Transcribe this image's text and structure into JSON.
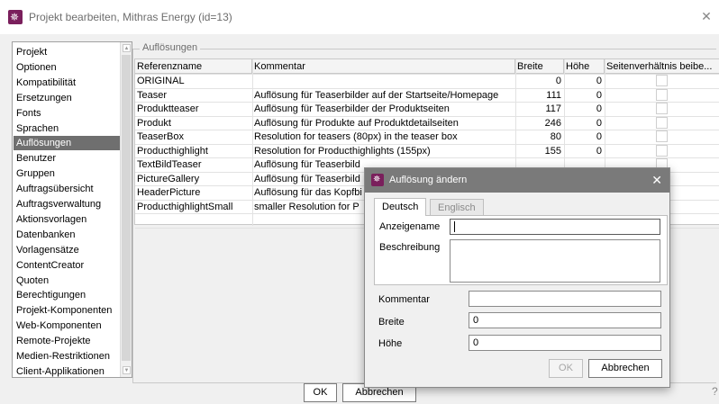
{
  "window": {
    "title": "Projekt bearbeiten, Mithras Energy (id=13)",
    "close_symbol": "✕"
  },
  "sidebar": {
    "items": [
      {
        "label": "Projekt",
        "selected": false
      },
      {
        "label": "Optionen",
        "selected": false
      },
      {
        "label": "Kompatibilität",
        "selected": false
      },
      {
        "label": "Ersetzungen",
        "selected": false
      },
      {
        "label": "Fonts",
        "selected": false
      },
      {
        "label": "Sprachen",
        "selected": false
      },
      {
        "label": "Auflösungen",
        "selected": true
      },
      {
        "label": "Benutzer",
        "selected": false
      },
      {
        "label": "Gruppen",
        "selected": false
      },
      {
        "label": "Auftragsübersicht",
        "selected": false
      },
      {
        "label": "Auftragsverwaltung",
        "selected": false
      },
      {
        "label": "Aktionsvorlagen",
        "selected": false
      },
      {
        "label": "Datenbanken",
        "selected": false
      },
      {
        "label": "Vorlagensätze",
        "selected": false
      },
      {
        "label": "ContentCreator",
        "selected": false
      },
      {
        "label": "Quoten",
        "selected": false
      },
      {
        "label": "Berechtigungen",
        "selected": false
      },
      {
        "label": "Projekt-Komponenten",
        "selected": false
      },
      {
        "label": "Web-Komponenten",
        "selected": false
      },
      {
        "label": "Remote-Projekte",
        "selected": false
      },
      {
        "label": "Medien-Restriktionen",
        "selected": false
      },
      {
        "label": "Client-Applikationen",
        "selected": false
      }
    ]
  },
  "resolutions": {
    "group_label": "Auflösungen",
    "columns": [
      "Referenzname",
      "Kommentar",
      "Breite",
      "Höhe",
      "Seitenverhältnis beibe..."
    ],
    "rows": [
      {
        "name": "ORIGINAL",
        "comment": "",
        "width": "0",
        "height": "0"
      },
      {
        "name": "Teaser",
        "comment": "Auflösung für Teaserbilder auf der Startseite/Homepage",
        "width": "111",
        "height": "0"
      },
      {
        "name": "Produktteaser",
        "comment": "Auflösung für Teaserbilder der Produktseiten",
        "width": "117",
        "height": "0"
      },
      {
        "name": "Produkt",
        "comment": "Auflösung für Produkte auf Produktdetailseiten",
        "width": "246",
        "height": "0"
      },
      {
        "name": "TeaserBox",
        "comment": "Resolution for teasers (80px) in the teaser box",
        "width": "80",
        "height": "0"
      },
      {
        "name": "Producthighlight",
        "comment": "Resolution for Producthighlights (155px)",
        "width": "155",
        "height": "0"
      },
      {
        "name": "TextBildTeaser",
        "comment": "Auflösung für Teaserbild",
        "width": "",
        "height": ""
      },
      {
        "name": "PictureGallery",
        "comment": "Auflösung für Teaserbild",
        "width": "",
        "height": ""
      },
      {
        "name": "HeaderPicture",
        "comment": "Auflösung für das Kopfbi",
        "width": "",
        "height": ""
      },
      {
        "name": "ProducthighlightSmall",
        "comment": "smaller Resolution for P",
        "width": "",
        "height": ""
      }
    ]
  },
  "footer": {
    "ok_label": "OK",
    "cancel_label": "Abbrechen",
    "help_symbol": "?"
  },
  "dialog": {
    "title": "Auflösung ändern",
    "close_symbol": "✕",
    "tabs": [
      {
        "label": "Deutsch",
        "active": true
      },
      {
        "label": "Englisch",
        "active": false
      }
    ],
    "display_name_label": "Anzeigename",
    "display_name_value": "",
    "description_label": "Beschreibung",
    "description_value": "",
    "comment_label": "Kommentar",
    "comment_value": "",
    "width_label": "Breite",
    "width_value": "0",
    "height_label": "Höhe",
    "height_value": "0",
    "ok_label": "OK",
    "cancel_label": "Abbrechen"
  },
  "colors": {
    "app_icon": "#7a1f5c",
    "selection": "#6f6f6f",
    "dialog_titlebar": "#7a7a7a"
  }
}
